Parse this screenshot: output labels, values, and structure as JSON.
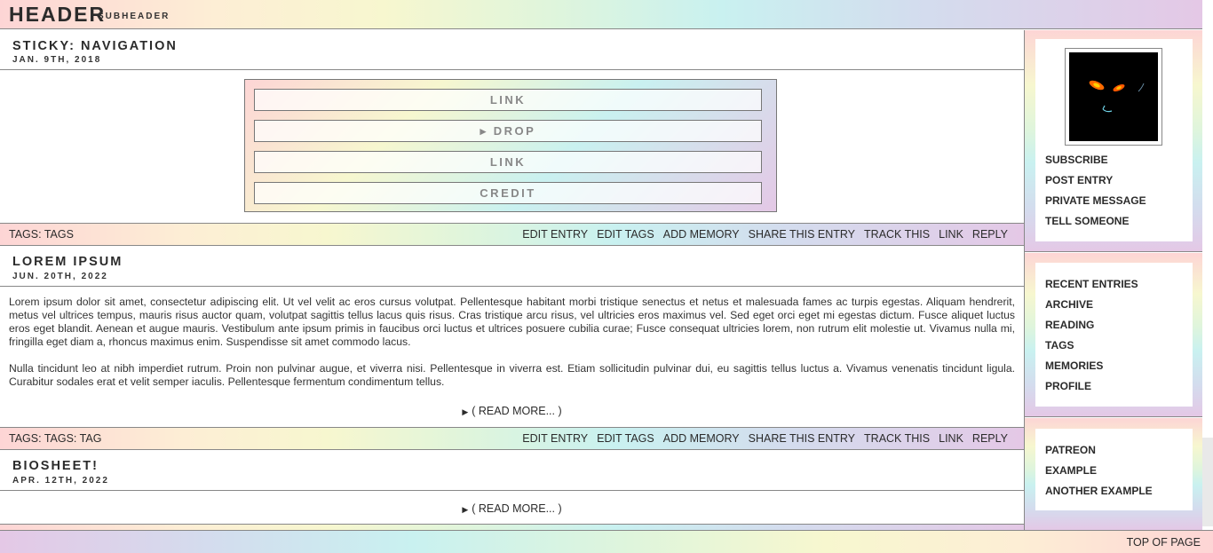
{
  "header": {
    "title": "HEADER",
    "subtitle": "SUBHEADER"
  },
  "sticky": {
    "title": "STICKY: NAVIGATION",
    "date": "JAN. 9TH, 2018",
    "links": [
      "LINK",
      "▸ DROP",
      "LINK",
      "CREDIT"
    ]
  },
  "entry_actions": [
    "EDIT ENTRY",
    "EDIT TAGS",
    "ADD MEMORY",
    "SHARE THIS ENTRY",
    "TRACK THIS",
    "LINK",
    "REPLY"
  ],
  "tagbars": [
    {
      "tags": "TAGS: TAGS"
    },
    {
      "tags": "TAGS: TAGS: TAG"
    }
  ],
  "entries": [
    {
      "title": "LOREM IPSUM",
      "date": "JUN. 20TH, 2022",
      "paragraphs": [
        "Lorem ipsum dolor sit amet, consectetur adipiscing elit. Ut vel velit ac eros cursus volutpat. Pellentesque habitant morbi tristique senectus et netus et malesuada fames ac turpis egestas. Aliquam hendrerit, metus vel ultrices tempus, mauris risus auctor quam, volutpat sagittis tellus lacus quis risus. Cras tristique arcu risus, vel ultricies eros maximus vel. Sed eget orci eget mi egestas dictum. Fusce aliquet luctus eros eget blandit. Aenean et augue mauris. Vestibulum ante ipsum primis in faucibus orci luctus et ultrices posuere cubilia curae; Fusce consequat ultricies lorem, non rutrum elit molestie ut. Vivamus nulla mi, fringilla eget diam a, rhoncus maximus enim. Suspendisse sit amet commodo lacus.",
        "Nulla tincidunt leo at nibh imperdiet rutrum. Proin non pulvinar augue, et viverra nisi. Pellentesque in viverra est. Etiam sollicitudin pulvinar dui, eu sagittis tellus luctus a. Vivamus venenatis tincidunt ligula. Curabitur sodales erat et velit semper iaculis. Pellentesque fermentum condimentum tellus."
      ],
      "read_more": "( READ MORE... )"
    },
    {
      "title": "BIOSHEET!",
      "date": "APR. 12TH, 2022",
      "read_more": "( READ MORE... )"
    }
  ],
  "sidebar": {
    "profile_links": [
      "SUBSCRIBE",
      "POST ENTRY",
      "PRIVATE MESSAGE",
      "TELL SOMEONE"
    ],
    "nav_links": [
      "RECENT ENTRIES",
      "ARCHIVE",
      "READING",
      "TAGS",
      "MEMORIES",
      "PROFILE"
    ],
    "extra_links": [
      "PATREON",
      "EXAMPLE",
      "ANOTHER EXAMPLE"
    ]
  },
  "footer": {
    "top_link": "TOP OF PAGE"
  }
}
